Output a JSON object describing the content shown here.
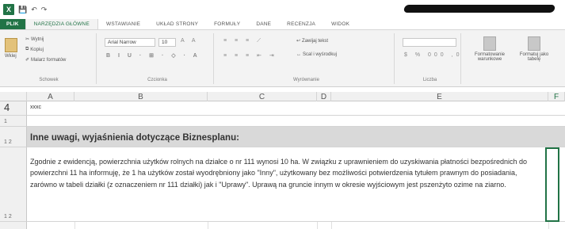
{
  "app": {
    "logo_letter": "X",
    "accent_color": "#217346",
    "quick_access": [
      "save-icon",
      "undo-icon",
      "redo-icon"
    ]
  },
  "tabs": [
    {
      "label": "PLIK",
      "kind": "file"
    },
    {
      "label": "NARZĘDZIA GŁÓWNE",
      "kind": "active"
    },
    {
      "label": "WSTAWIANIE",
      "kind": "normal"
    },
    {
      "label": "UKŁAD STRONY",
      "kind": "normal"
    },
    {
      "label": "FORMUŁY",
      "kind": "normal"
    },
    {
      "label": "DANE",
      "kind": "normal"
    },
    {
      "label": "RECENZJA",
      "kind": "normal"
    },
    {
      "label": "WIDOK",
      "kind": "normal"
    }
  ],
  "ribbon": {
    "clipboard": {
      "paste_label": "Wklej",
      "cut_label": "Wytnij",
      "copy_label": "Kopiuj",
      "format_painter_label": "Malarz formatów",
      "group_label": "Schowek"
    },
    "font": {
      "font_name": "Arial Narrow",
      "font_size": "10",
      "group_label": "Czcionka"
    },
    "alignment": {
      "wrap_label": "Zawijaj tekst",
      "merge_label": "Scal i wyśrodkuj",
      "group_label": "Wyrównanie"
    },
    "number": {
      "format_value": "",
      "group_label": "Liczba"
    },
    "styles": {
      "conditional_label": "Formatowanie warunkowe",
      "table_label": "Formatuj jako tabelę"
    }
  },
  "sheet": {
    "columns": [
      "A",
      "B",
      "C",
      "D",
      "E",
      "F"
    ],
    "row4": {
      "number": "4",
      "value": "xxxc"
    },
    "row_small_1": {
      "number": "1"
    },
    "heading_row": {
      "number": "1 2",
      "text": "Inne uwagi, wyjaśnienia dotyczące Biznesplanu:"
    },
    "content_row": {
      "number": "1 2",
      "text": "Zgodnie z ewidencją, powierzchnia użytków rolnych na działce o nr 111 wynosi 10 ha. W związku z uprawnieniem do uzyskiwania płatności bezpośrednich do powierzchni 11 ha informuję, że 1 ha użytków został wyodrębniony jako \"Inny\", użytkowany bez możliwości potwierdzenia tytułem prawnym do posiadania, zarówno w tabeli działki (z oznaczeniem nr 111 działki) jak i \"Uprawy\". Uprawą na gruncie innym w okresie wyjściowym jest pszenżyto ozime na ziarno."
    }
  }
}
